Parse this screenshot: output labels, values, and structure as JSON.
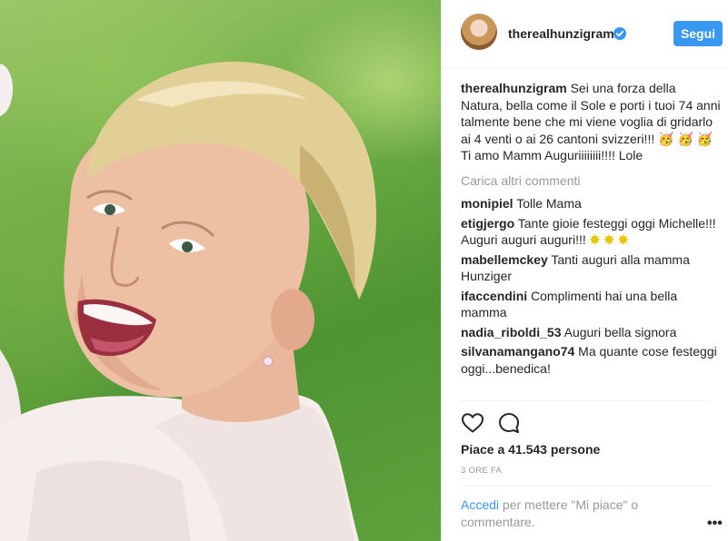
{
  "header": {
    "username": "therealhunzigram",
    "follow_label": "Segui"
  },
  "caption": {
    "username": "therealhunzigram",
    "text": "Sei una forza della Natura, bella come il Sole e porti i tuoi 74 anni talmente bene che mi viene voglia di gridarlo ai 4 venti o ai 26 cantoni svizzeri!!!",
    "emoji": "🥳 🥳 🥳",
    "text2": "Ti amo Mamm Auguriiiiiiii!!!! Lole"
  },
  "load_more": "Carica altri commenti",
  "comments": [
    {
      "user": "monipiel",
      "text": "Tolle Mama"
    },
    {
      "user": "etigjergo",
      "text": "Tante gioie festeggi oggi Michelle!!! Auguri auguri auguri!!!",
      "stars": "✸ ✸ ✸"
    },
    {
      "user": "mabellemckey",
      "text": "Tanti auguri alla mamma Hunziger"
    },
    {
      "user": "ifaccendini",
      "text": "Complimenti hai una bella mamma"
    },
    {
      "user": "nadia_riboldi_53",
      "text": "Auguri bella signora"
    },
    {
      "user": "silvanamangano74",
      "text": "Ma quante cose festeggi oggi...benedica!"
    }
  ],
  "likes": "Piace a 41.543 persone",
  "timestamp": "3 ORE FA",
  "login_prompt": {
    "link": "Accedi",
    "text": " per mettere \"Mi piace\" o commentare."
  },
  "more_options": "•••",
  "icons": [
    "verified-badge-icon",
    "heart-icon",
    "comment-icon",
    "more-options-icon"
  ],
  "colors": {
    "accent": "#3897f0",
    "text": "#262626",
    "muted": "#999999"
  }
}
